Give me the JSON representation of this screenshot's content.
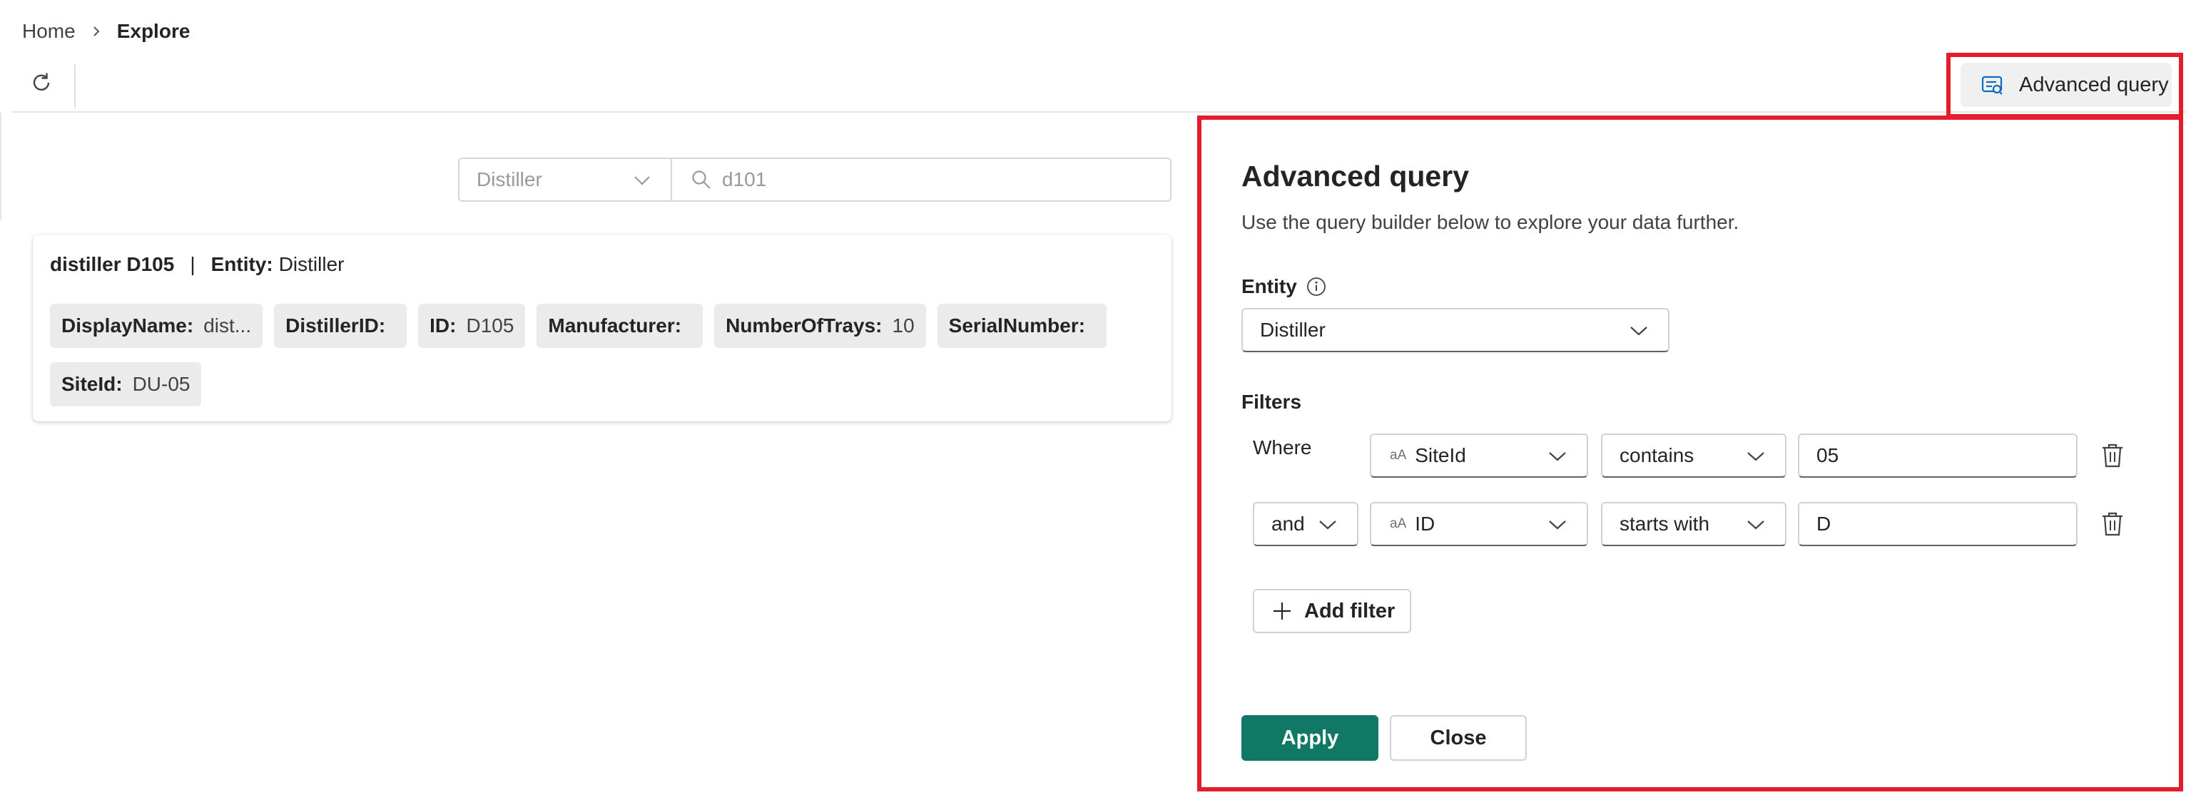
{
  "breadcrumb": {
    "home": "Home",
    "current": "Explore"
  },
  "toolbar": {
    "refresh_icon": "refresh-icon",
    "advanced_query_label": "Advanced query",
    "advanced_query_icon": "query-icon"
  },
  "search": {
    "entity_value": "Distiller",
    "query_value": "d101"
  },
  "result": {
    "name": "distiller D105",
    "separator": "|",
    "entity_label": "Entity:",
    "entity_value": "Distiller",
    "chips": [
      {
        "key": "DisplayName:",
        "value": "dist..."
      },
      {
        "key": "DistillerID:",
        "value": ""
      },
      {
        "key": "ID:",
        "value": "D105"
      },
      {
        "key": "Manufacturer:",
        "value": ""
      },
      {
        "key": "NumberOfTrays:",
        "value": "10"
      },
      {
        "key": "SerialNumber:",
        "value": ""
      },
      {
        "key": "SiteId:",
        "value": "DU-05"
      }
    ]
  },
  "panel": {
    "title": "Advanced query",
    "description": "Use the query builder below to explore your data further.",
    "entity_label": "Entity",
    "entity_value": "Distiller",
    "filters_label": "Filters",
    "where_label": "Where",
    "filter_rows": [
      {
        "connector": "",
        "type_hint": "aA",
        "property": "SiteId",
        "operator": "contains",
        "value": "05"
      },
      {
        "connector": "and",
        "type_hint": "aA",
        "property": "ID",
        "operator": "starts with",
        "value": "D"
      }
    ],
    "add_filter_label": "Add filter",
    "apply_label": "Apply",
    "close_label": "Close"
  },
  "colors": {
    "highlight": "#e41c2c",
    "primary": "#117865"
  }
}
